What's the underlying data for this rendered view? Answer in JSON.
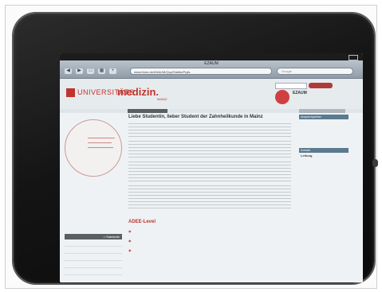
{
  "browser": {
    "page_title": "EZAUM",
    "url": "www.blum.de/ANAUM/Quy/StaMa/Pujts",
    "search_placeholder": "Google"
  },
  "site": {
    "logo_part1": "UNIVERSITÄTS",
    "logo_part2": "medizin.",
    "logo_sub": "MAINZ",
    "ezaum_title": "EZAUM"
  },
  "main": {
    "heading": "Liebe Studentin, lieber Student der Zahnheilkunde in Mainz",
    "adee_title": "ADEE-Level"
  },
  "leftnav": {
    "head": "> Startseite"
  },
  "right": {
    "box1_head": "Ansprechpartner",
    "box2_head": "Kontakt",
    "contact_name": "Leitung"
  },
  "icons": [
    "back-arrow-icon",
    "forward-arrow-icon",
    "bookmarks-icon",
    "tabs-icon",
    "add-icon",
    "reload-icon"
  ],
  "colors": {
    "brand_red": "#c0342d",
    "toolbar": "#9aa6b2",
    "device_bezel": "#141414"
  }
}
